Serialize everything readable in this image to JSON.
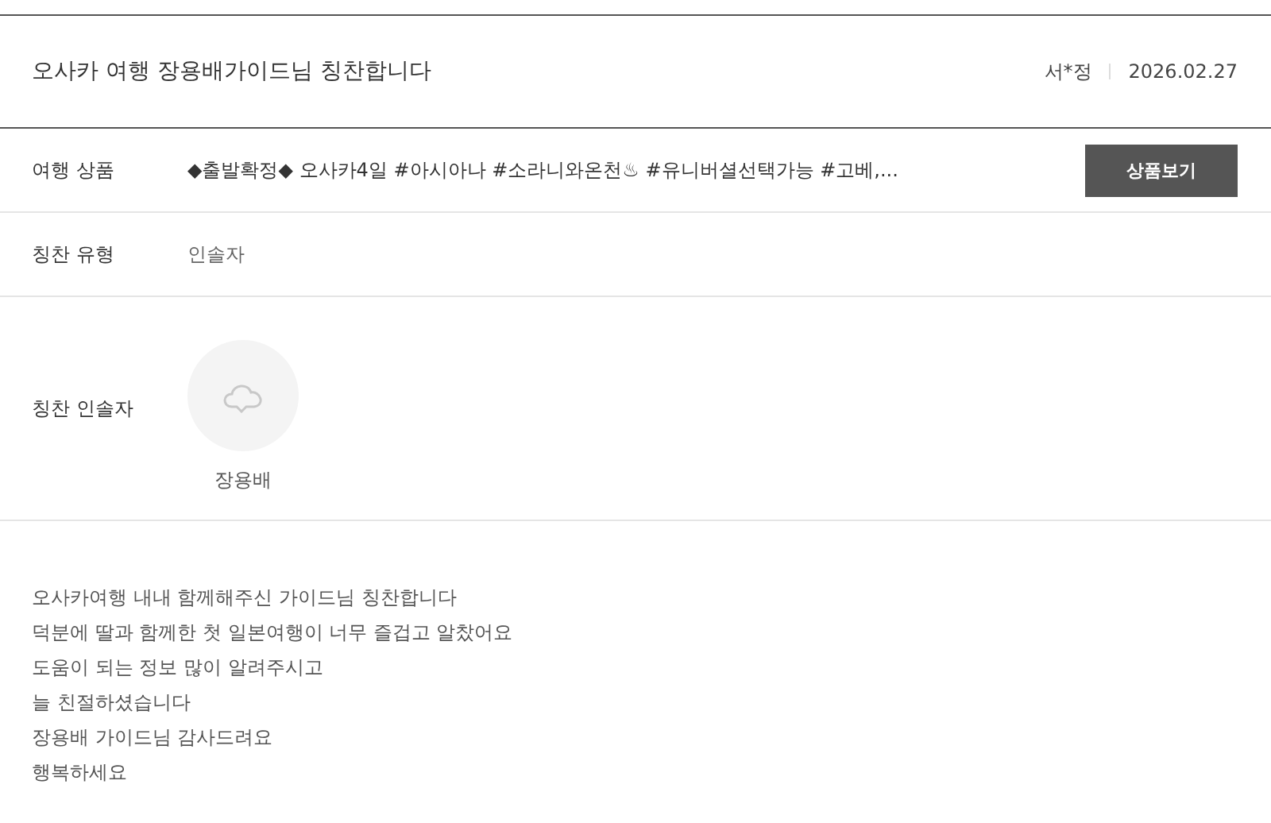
{
  "header": {
    "title": "오사카 여행 장용배가이드님 칭찬합니다",
    "author": "서*정",
    "date": "2026.02.27"
  },
  "rows": [
    {
      "kind": "product",
      "label": "여행 상품",
      "value": "◆출발확정◆ 오사카4일 #아시아나 #소라니와온천♨ #유니버셜선택가능 #고베,...",
      "button": "상품보기"
    },
    {
      "kind": "text",
      "label": "칭찬 유형",
      "value": "인솔자"
    },
    {
      "kind": "person",
      "label": "칭찬 인솔자",
      "name": "장용배"
    }
  ],
  "body": [
    "오사카여행 내내 함께해주신 가이드님 칭찬합니다",
    "덕분에 딸과 함께한 첫 일본여행이 너무 즐겁고 알찼어요",
    "도움이 되는 정보 많이 알려주시고",
    "늘 친절하셨습니다",
    "장용배 가이드님 감사드려요",
    "행복하세요"
  ]
}
